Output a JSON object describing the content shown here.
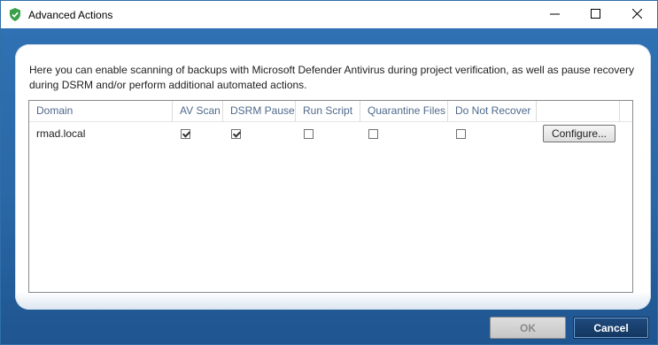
{
  "window": {
    "title": "Advanced Actions"
  },
  "description": "Here you can enable scanning of backups with Microsoft Defender Antivirus during project verification, as well as pause recovery during DSRM and/or perform additional automated actions.",
  "table": {
    "columns": [
      "Domain",
      "AV Scan",
      "DSRM Pause",
      "Run Script",
      "Quarantine Files",
      "Do Not Recover"
    ],
    "rows": [
      {
        "domain": "rmad.local",
        "av_scan": true,
        "dsrm_pause": true,
        "run_script": false,
        "quarantine_files": false,
        "do_not_recover": false,
        "configure_label": "Configure..."
      }
    ]
  },
  "buttons": {
    "ok_label": "OK",
    "ok_enabled": false,
    "cancel_label": "Cancel"
  },
  "colors": {
    "accent": "#2f71b3",
    "shield": "#3aa14a"
  },
  "icons": {
    "app": "shield-check-icon",
    "minimize": "minimize-icon",
    "maximize": "maximize-icon",
    "close": "close-icon"
  }
}
